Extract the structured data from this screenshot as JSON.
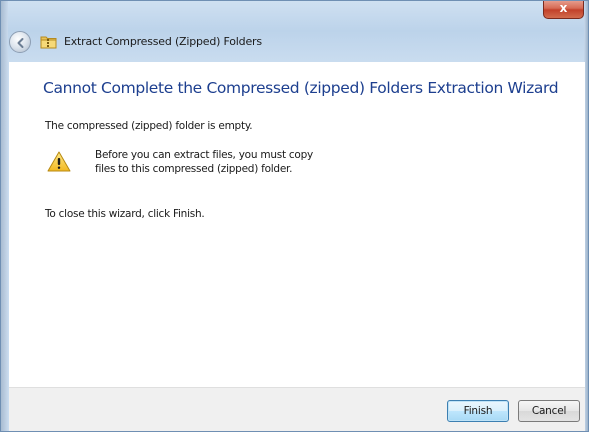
{
  "window": {
    "close_glyph": "x"
  },
  "nav": {
    "back_icon": "back-arrow-icon",
    "folder_icon": "zipped-folder-icon",
    "title": "Extract Compressed (Zipped) Folders"
  },
  "content": {
    "heading": "Cannot Complete the Compressed (zipped) Folders Extraction Wizard",
    "empty_message": "The compressed (zipped) folder is empty.",
    "warning_icon": "warning-icon",
    "copy_message_line1": "Before you can extract files, you must copy",
    "copy_message_line2": "files to this compressed (zipped) folder.",
    "close_instruction": "To close this wizard, click Finish."
  },
  "footer": {
    "finish_label": "Finish",
    "cancel_label": "Cancel"
  },
  "colors": {
    "heading": "#1d3f8f",
    "close_button": "#c2412a",
    "frame": "#bcd3ea"
  }
}
